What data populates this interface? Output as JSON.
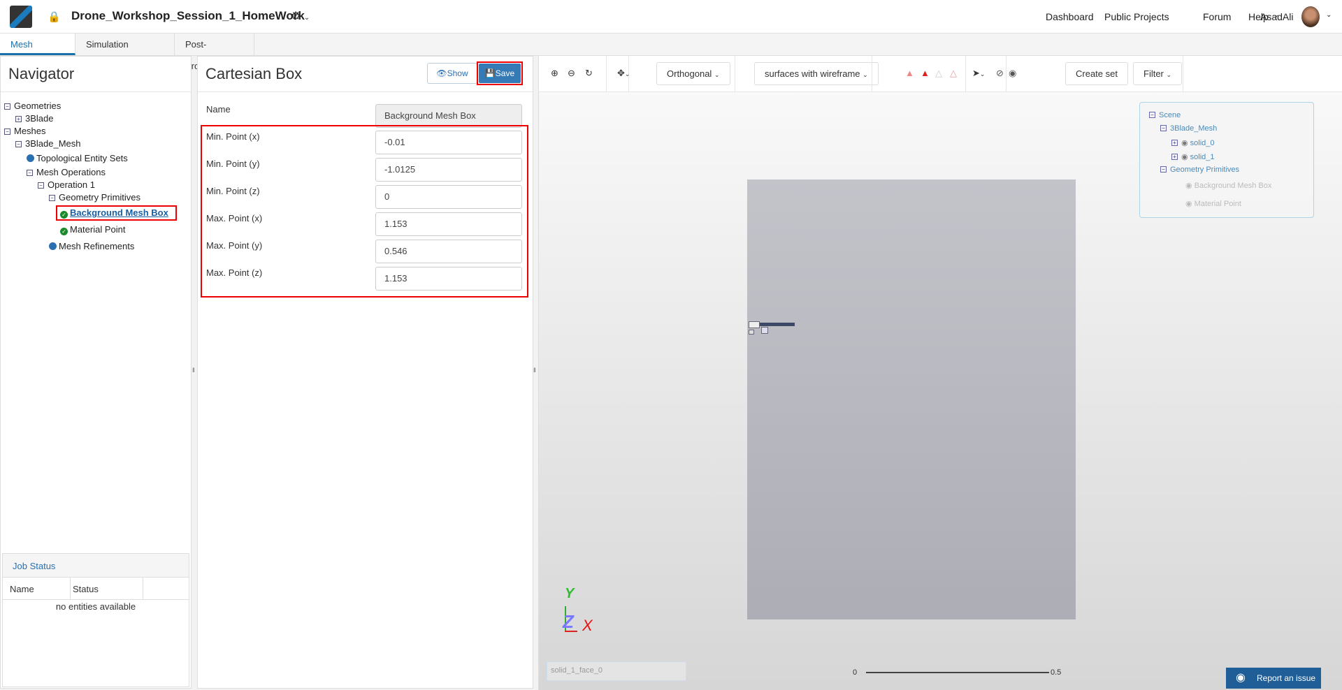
{
  "header": {
    "project_title": "Drone_Workshop_Session_1_HomeWork",
    "nav": [
      "Dashboard",
      "Public Projects",
      "Forum",
      "Help"
    ],
    "user": "AsadAli"
  },
  "tabs": [
    "Mesh Creator",
    "Simulation Designer",
    "Post-Processor"
  ],
  "navigator": {
    "title": "Navigator",
    "tree": [
      {
        "label": "Geometries",
        "icon": "minus"
      },
      {
        "label": "3Blade",
        "icon": "plus"
      },
      {
        "label": "Meshes",
        "icon": "minus"
      },
      {
        "label": "3Blade_Mesh",
        "icon": "minus"
      },
      {
        "label": "Topological Entity Sets",
        "icon": "dot"
      },
      {
        "label": "Mesh Operations",
        "icon": "minus"
      },
      {
        "label": "Operation 1",
        "icon": "minus"
      },
      {
        "label": "Geometry Primitives",
        "icon": "minus"
      },
      {
        "label": "Background Mesh Box",
        "icon": "check"
      },
      {
        "label": "Material Point",
        "icon": "check"
      },
      {
        "label": "Mesh Refinements",
        "icon": "dot"
      }
    ]
  },
  "job_status": {
    "title": "Job Status",
    "columns": [
      "Name",
      "Status"
    ],
    "empty": "no entities available"
  },
  "form": {
    "title": "Cartesian Box",
    "show_label": "Show",
    "save_label": "Save",
    "name_label": "Name",
    "name_value": "Background Mesh Box",
    "fields": [
      {
        "label": "Min. Point (x)",
        "value": "-0.01"
      },
      {
        "label": "Min. Point (y)",
        "value": "-1.0125"
      },
      {
        "label": "Min. Point (z)",
        "value": "0"
      },
      {
        "label": "Max. Point (x)",
        "value": "1.153"
      },
      {
        "label": "Max. Point (y)",
        "value": "0.546"
      },
      {
        "label": "Max. Point (z)",
        "value": "1.153"
      }
    ]
  },
  "toolbar": {
    "projection": "Orthogonal",
    "render_mode": "surfaces with wireframe",
    "create_set": "Create set",
    "filter": "Filter"
  },
  "scene": {
    "root": "Scene",
    "mesh": "3Blade_Mesh",
    "solids": [
      "solid_0",
      "solid_1"
    ],
    "primitives": "Geometry Primitives",
    "prim_items": [
      "Background Mesh Box",
      "Material Point"
    ]
  },
  "viewer": {
    "axes": {
      "y": "Y",
      "z": "Z",
      "x": "X"
    },
    "selection_box": "solid_1_face_0",
    "scale_min": "0",
    "scale_max": "0.5",
    "report": "Report an issue"
  }
}
